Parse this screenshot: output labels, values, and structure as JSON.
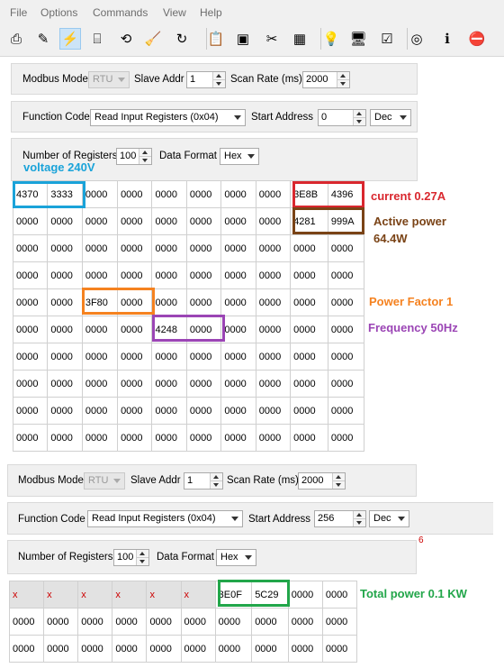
{
  "menu": [
    "File",
    "Options",
    "Commands",
    "View",
    "Help"
  ],
  "toolbar_icons": [
    "new-file-icon",
    "open-file-icon",
    "connect-icon",
    "disconnect-icon",
    "settings-icon",
    "clear-icon",
    "refresh-icon",
    "log-icon",
    "monitor-icon",
    "tools-icon",
    "table-icon",
    "bulb-icon",
    "device-icon",
    "check-icon",
    "help-ring-icon",
    "info-icon",
    "close-icon"
  ],
  "toolbar_glyphs": [
    "⎙",
    "✎",
    "⚡",
    "⌸",
    "⟲",
    "🧹",
    "↻",
    "📋",
    "▣",
    "✂",
    "▦",
    "💡",
    "🖥",
    "☑",
    "◎",
    "ℹ",
    "⛔"
  ],
  "top": {
    "modbus_mode_label": "Modbus Mode",
    "modbus_mode": "RTU",
    "slave_addr_label": "Slave Addr",
    "slave_addr": "1",
    "scan_rate_label": "Scan Rate (ms)",
    "scan_rate": "2000",
    "function_code_label": "Function Code",
    "function_code": "Read Input Registers (0x04)",
    "start_address_label": "Start Address",
    "start_address": "0",
    "address_format": "Dec",
    "num_registers_label": "Number of Registers",
    "num_registers": "100",
    "data_format_label": "Data Format",
    "data_format": "Hex",
    "rows": [
      [
        "4370",
        "3333",
        "0000",
        "0000",
        "0000",
        "0000",
        "0000",
        "0000",
        "3E8B",
        "4396"
      ],
      [
        "0000",
        "0000",
        "0000",
        "0000",
        "0000",
        "0000",
        "0000",
        "0000",
        "4281",
        "999A"
      ],
      [
        "0000",
        "0000",
        "0000",
        "0000",
        "0000",
        "0000",
        "0000",
        "0000",
        "0000",
        "0000"
      ],
      [
        "0000",
        "0000",
        "0000",
        "0000",
        "0000",
        "0000",
        "0000",
        "0000",
        "0000",
        "0000"
      ],
      [
        "0000",
        "0000",
        "3F80",
        "0000",
        "0000",
        "0000",
        "0000",
        "0000",
        "0000",
        "0000"
      ],
      [
        "0000",
        "0000",
        "0000",
        "0000",
        "4248",
        "0000",
        "0000",
        "0000",
        "0000",
        "0000"
      ],
      [
        "0000",
        "0000",
        "0000",
        "0000",
        "0000",
        "0000",
        "0000",
        "0000",
        "0000",
        "0000"
      ],
      [
        "0000",
        "0000",
        "0000",
        "0000",
        "0000",
        "0000",
        "0000",
        "0000",
        "0000",
        "0000"
      ],
      [
        "0000",
        "0000",
        "0000",
        "0000",
        "0000",
        "0000",
        "0000",
        "0000",
        "0000",
        "0000"
      ],
      [
        "0000",
        "0000",
        "0000",
        "0000",
        "0000",
        "0000",
        "0000",
        "0000",
        "0000",
        "0000"
      ]
    ]
  },
  "bottom": {
    "modbus_mode_label": "Modbus Mode",
    "modbus_mode": "RTU",
    "slave_addr_label": "Slave Addr",
    "slave_addr": "1",
    "scan_rate_label": "Scan Rate (ms)",
    "scan_rate": "2000",
    "function_code_label": "Function Code",
    "function_code": "Read Input Registers (0x04)",
    "start_address_label": "Start Address",
    "start_address": "256",
    "address_format": "Dec",
    "num_registers_label": "Number of Registers",
    "num_registers": "100",
    "data_format_label": "Data Format",
    "data_format": "Hex",
    "stray_mark": "6",
    "rows": [
      [
        "x",
        "x",
        "x",
        "x",
        "x",
        "x",
        "3E0F",
        "5C29",
        "0000",
        "0000"
      ],
      [
        "0000",
        "0000",
        "0000",
        "0000",
        "0000",
        "0000",
        "0000",
        "0000",
        "0000",
        "0000"
      ],
      [
        "0000",
        "0000",
        "0000",
        "0000",
        "0000",
        "0000",
        "0000",
        "0000",
        "0000",
        "0000"
      ]
    ]
  },
  "annotations": {
    "voltage": "voltage 240V",
    "current": "current 0.27A",
    "active_power": "Active power\n64.4W",
    "power_factor": "Power Factor 1",
    "frequency": "Frequency 50Hz",
    "total_power": "Total power 0.1 KW"
  },
  "colors": {
    "voltage": "#1aa3d9",
    "current": "#d9272e",
    "active_power": "#7a4316",
    "power_factor": "#f58220",
    "frequency": "#9b45b5",
    "total_power": "#22a64a"
  }
}
